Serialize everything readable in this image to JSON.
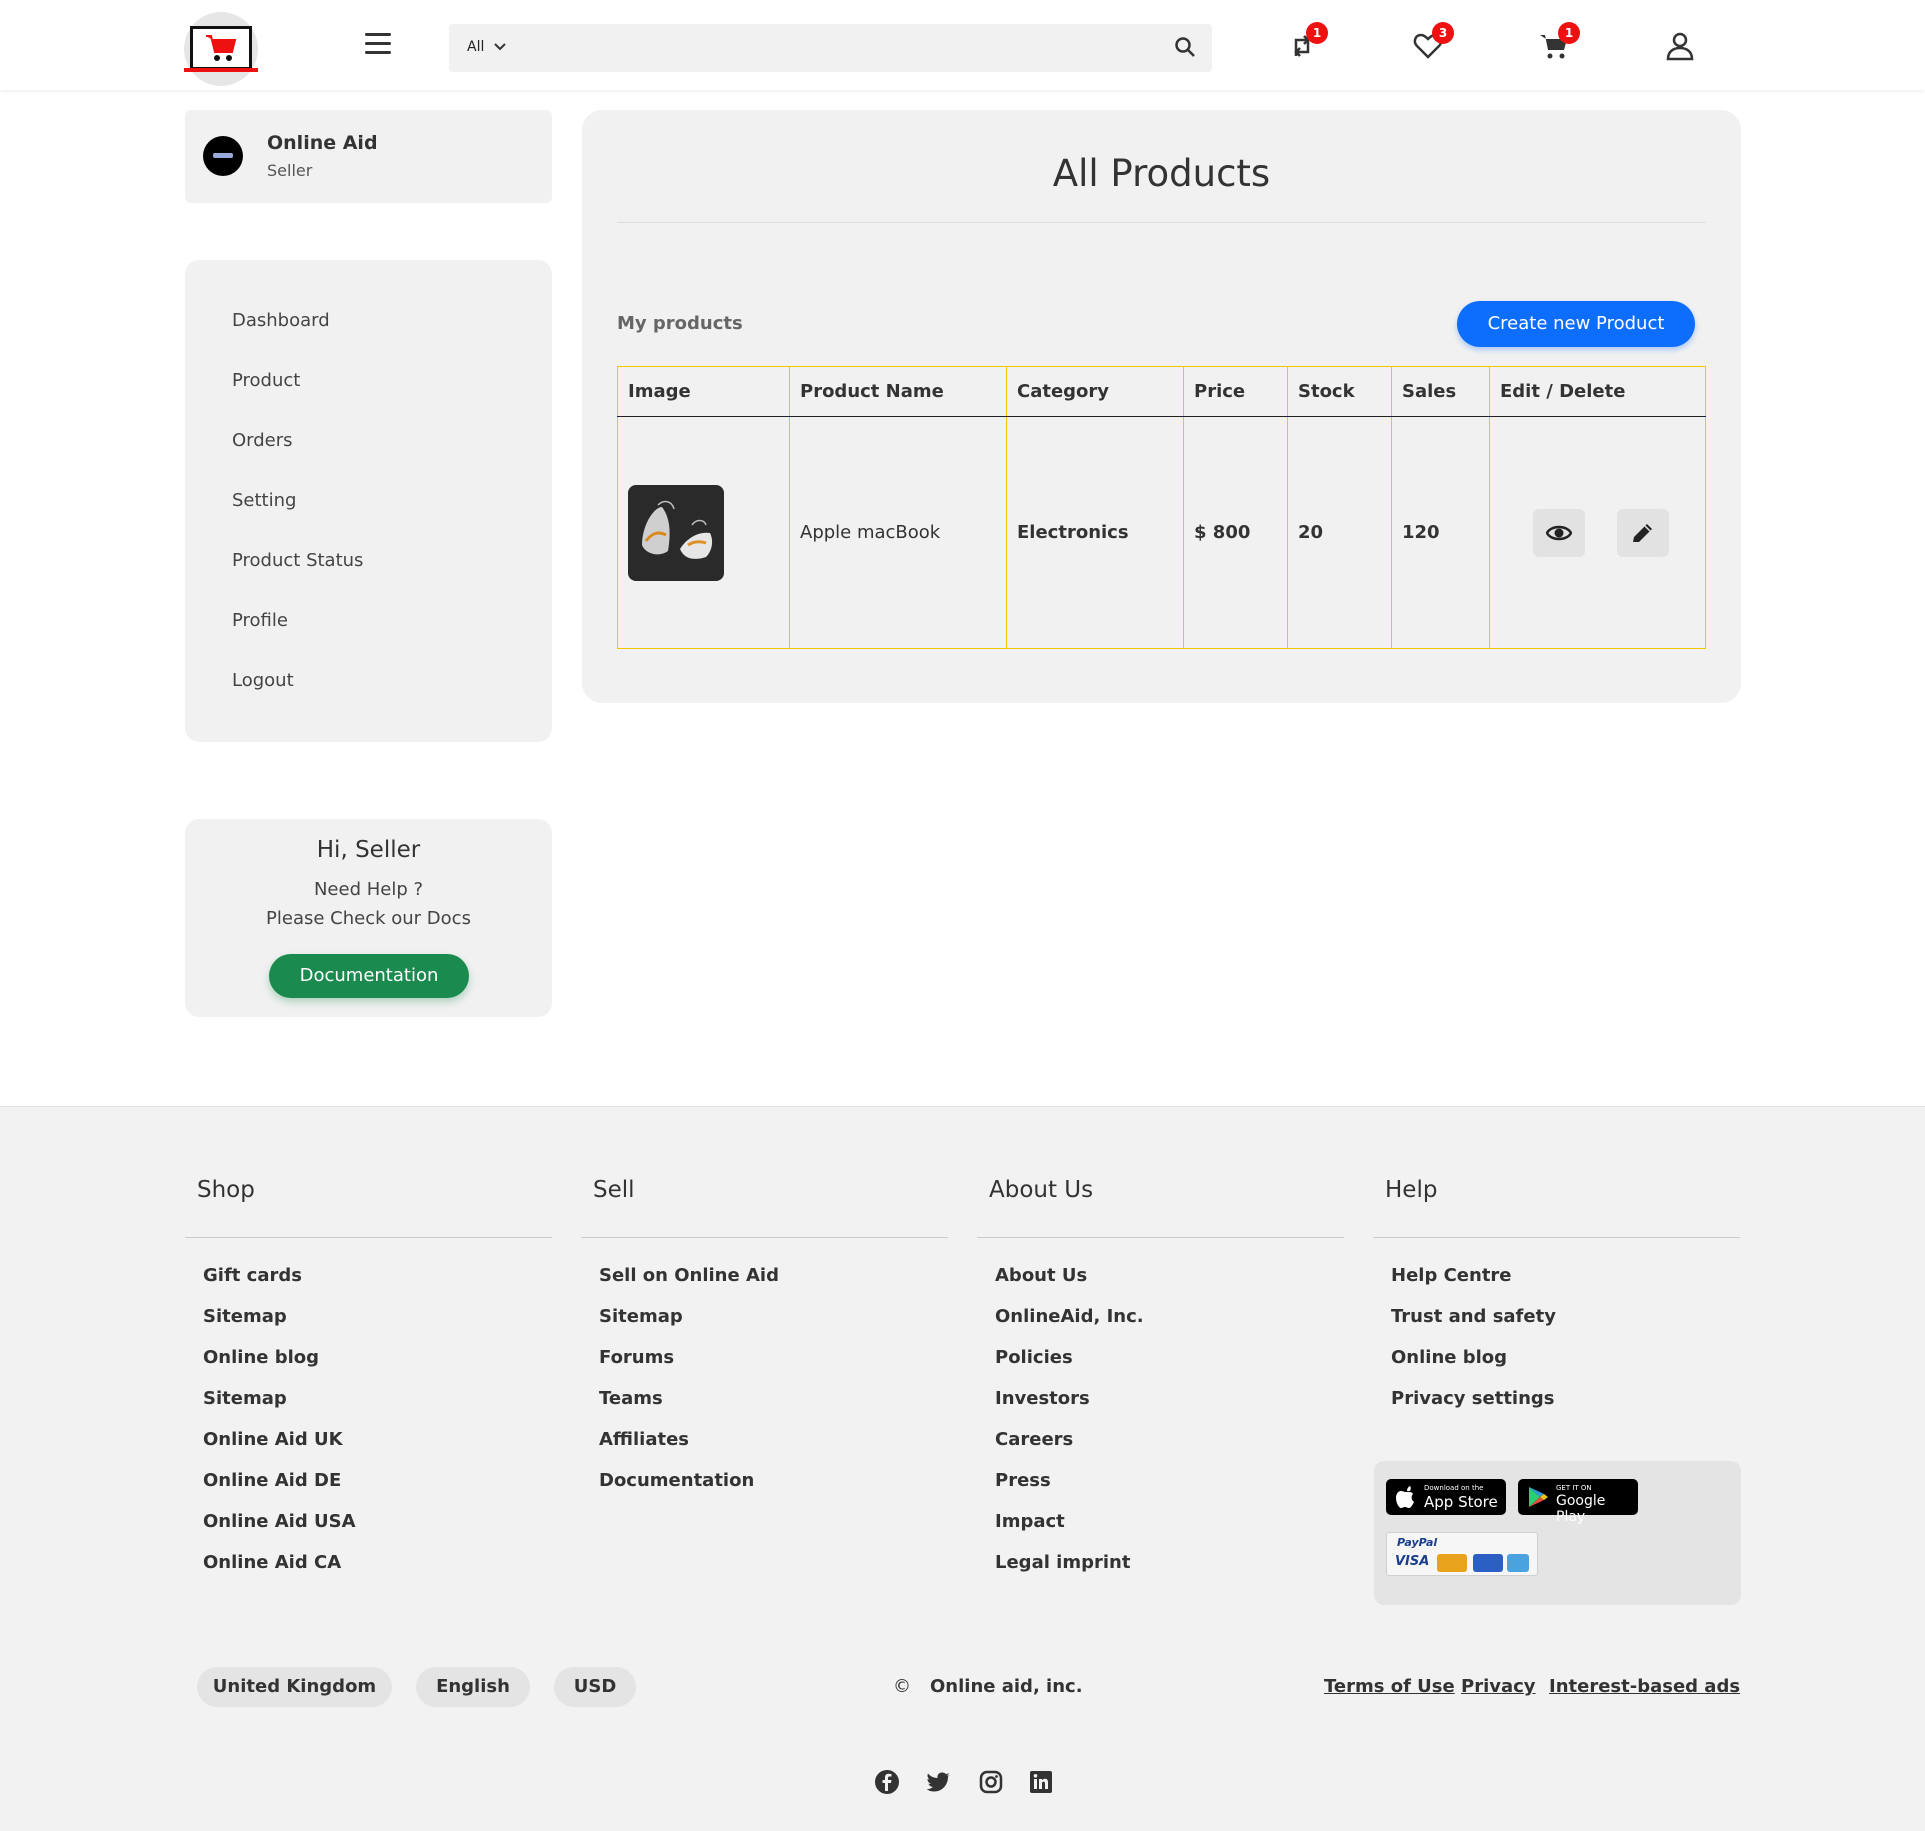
{
  "header": {
    "search_category": "All",
    "search_placeholder": "",
    "badges": {
      "compare": "1",
      "wishlist": "3",
      "cart": "1"
    }
  },
  "seller": {
    "name": "Online Aid",
    "role": "Seller"
  },
  "sidebar": {
    "items": [
      "Dashboard",
      "Product",
      "Orders",
      "Setting",
      "Product Status",
      "Profile",
      "Logout"
    ]
  },
  "help": {
    "greeting": "Hi, Seller",
    "line1": "Need Help ?",
    "line2": "Please Check our Docs",
    "button": "Documentation"
  },
  "main": {
    "title": "All Products",
    "subtitle": "My products",
    "create_button": "Create new Product",
    "columns": [
      "Image",
      "Product Name",
      "Category",
      "Price",
      "Stock",
      "Sales",
      "Edit / Delete"
    ],
    "rows": [
      {
        "name": "Apple macBook",
        "category": "Electronics",
        "price": "$ 800",
        "stock": "20",
        "sales": "120"
      }
    ]
  },
  "footer": {
    "shop": {
      "title": "Shop",
      "links": [
        "Gift cards",
        "Sitemap",
        "Online blog",
        "Sitemap",
        "Online Aid UK",
        "Online Aid DE",
        "Online Aid USA",
        "Online Aid CA"
      ]
    },
    "sell": {
      "title": "Sell",
      "links": [
        "Sell on Online Aid",
        "Sitemap",
        "Forums",
        "Teams",
        "Affiliates",
        "Documentation"
      ]
    },
    "about": {
      "title": "About Us",
      "links": [
        "About Us",
        "OnlineAid, Inc.",
        "Policies",
        "Investors",
        "Careers",
        "Press",
        "Impact",
        "Legal imprint"
      ]
    },
    "help": {
      "title": "Help",
      "links": [
        "Help Centre",
        "Trust and safety",
        "Online blog",
        "Privacy settings"
      ]
    },
    "app_store": {
      "small": "Download on the",
      "large": "App Store"
    },
    "google_play": {
      "small": "GET IT ON",
      "large": "Google Play"
    },
    "payment": {
      "paypal": "PayPal",
      "visa": "VISA"
    },
    "country": "United Kingdom",
    "language": "English",
    "currency": "USD",
    "copyright_symbol": "©",
    "copyright": "Online aid, inc.",
    "legal_links": [
      "Terms of Use",
      "Privacy",
      "Interest-based ads"
    ]
  },
  "colors": {
    "accent": "#0d6efd",
    "doc_button": "#1a8a4f",
    "badge": "#e11111",
    "table_border": "#f0c800"
  }
}
